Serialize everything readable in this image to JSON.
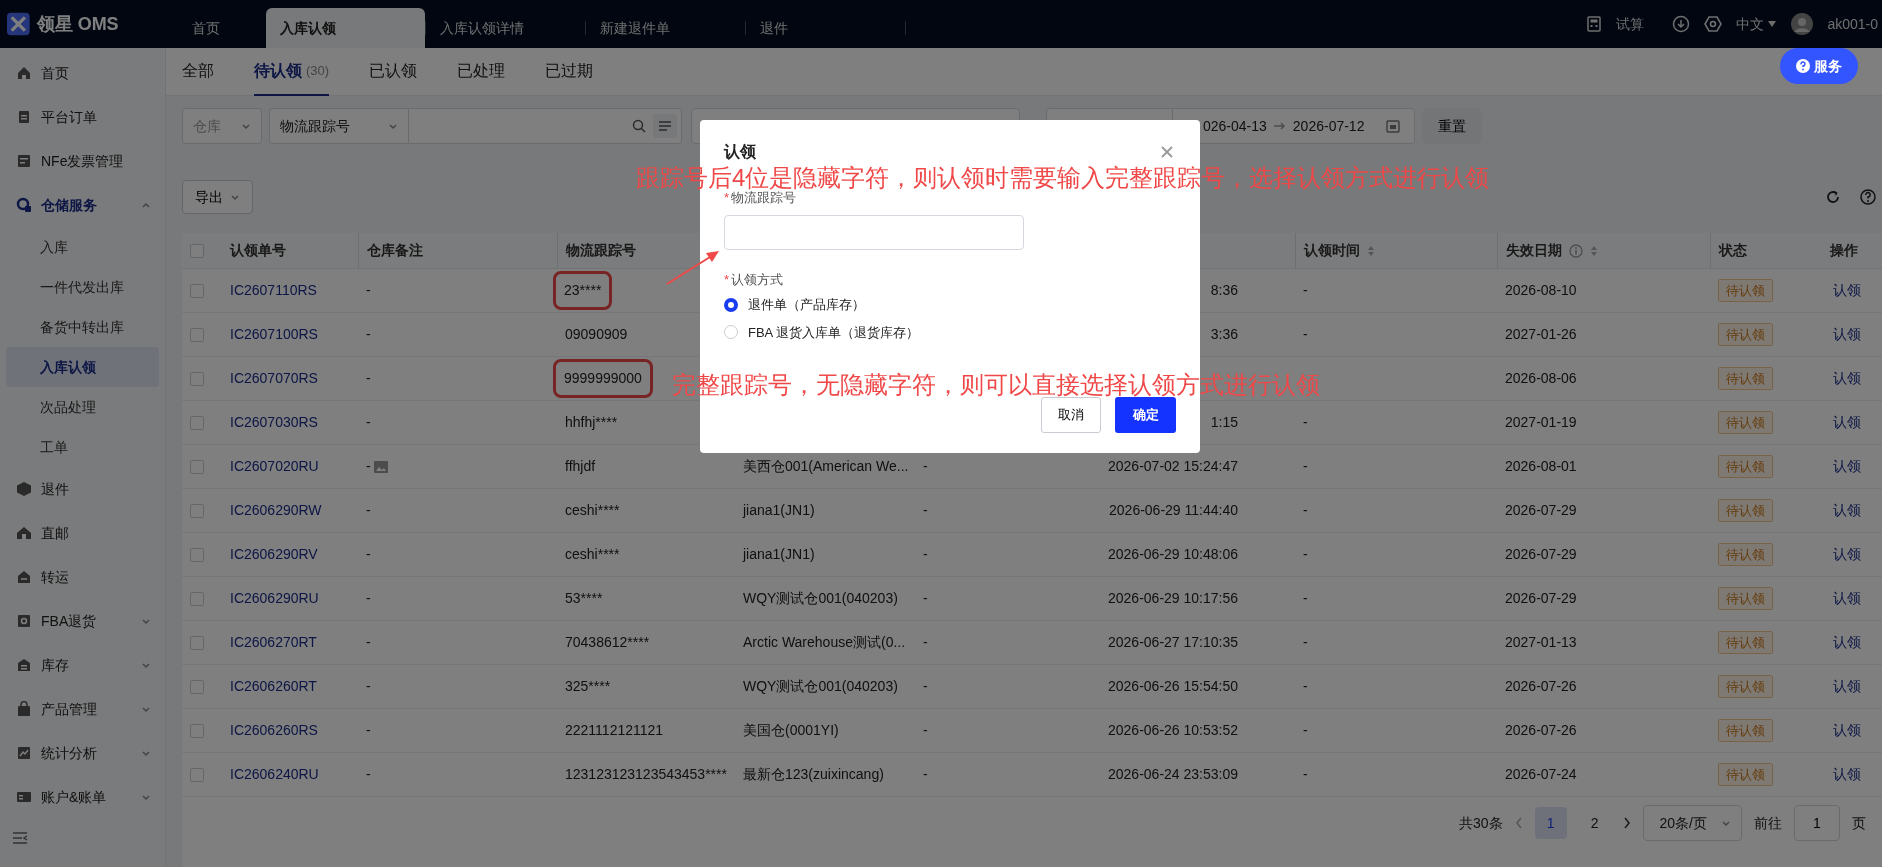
{
  "app": {
    "name": "领星 OMS"
  },
  "top_tabs": [
    {
      "label": "首页",
      "selected": false
    },
    {
      "label": "入库认领",
      "selected": true
    },
    {
      "label": "入库认领详情",
      "selected": false
    },
    {
      "label": "新建退件单",
      "selected": false
    },
    {
      "label": "退件",
      "selected": false
    }
  ],
  "top_right": {
    "calc": "试算",
    "language": "中文",
    "user": "ak001-0"
  },
  "service_button": "服务",
  "sidebar": {
    "items": [
      {
        "label": "首页"
      },
      {
        "label": "平台订单"
      },
      {
        "label": "NFe发票管理"
      },
      {
        "label": "仓储服务",
        "expanded": true,
        "children": [
          {
            "label": "入库",
            "selected": false
          },
          {
            "label": "一件代发出库",
            "selected": false
          },
          {
            "label": "备货中转出库",
            "selected": false
          },
          {
            "label": "入库认领",
            "selected": true
          },
          {
            "label": "次品处理",
            "selected": false
          },
          {
            "label": "工单",
            "selected": false
          }
        ]
      },
      {
        "label": "退件"
      },
      {
        "label": "直邮"
      },
      {
        "label": "转运"
      },
      {
        "label": "FBA退货",
        "expanded": false
      },
      {
        "label": "库存",
        "expanded": false
      },
      {
        "label": "产品管理",
        "expanded": false
      },
      {
        "label": "统计分析",
        "expanded": false
      },
      {
        "label": "账户&账单",
        "expanded": false
      }
    ]
  },
  "status_tabs": [
    {
      "label": "全部",
      "selected": false
    },
    {
      "label": "待认领",
      "count": "(30)",
      "selected": true
    },
    {
      "label": "已认领",
      "selected": false
    },
    {
      "label": "已处理",
      "selected": false
    },
    {
      "label": "已过期",
      "selected": false
    }
  ],
  "filters": {
    "warehouse_placeholder": "仓库",
    "search_type": "物流跟踪号",
    "date_start": "026-04-13",
    "date_end": "2026-07-12",
    "reset": "重置"
  },
  "export_button": "导出",
  "table": {
    "all_checked": false,
    "columns": [
      {
        "label": "认领单号"
      },
      {
        "label": "仓库备注"
      },
      {
        "label": "物流跟踪号"
      },
      {
        "label": "认领时间",
        "sortable": true
      },
      {
        "label": "失效日期",
        "sortable": true,
        "info": true
      },
      {
        "label": "状态"
      },
      {
        "label": "操作"
      }
    ],
    "rows": [
      {
        "checked": false,
        "id": "IC2607110RS",
        "remark": "-",
        "tracking": "23****",
        "highlighted": true,
        "column_6": "8:36",
        "claim_time": "-",
        "expiry": "2026-08-10",
        "status": "待认领",
        "action": "认领"
      },
      {
        "checked": false,
        "id": "IC2607100RS",
        "remark": "-",
        "tracking": "09090909",
        "highlighted": false,
        "column_6": "3:36",
        "claim_time": "-",
        "expiry": "2027-01-26",
        "status": "待认领",
        "action": "认领"
      },
      {
        "checked": false,
        "id": "IC2607070RS",
        "remark": "-",
        "tracking": "9999999000",
        "highlighted": true,
        "expiry": "2026-08-06",
        "status": "待认领",
        "action": "认领"
      },
      {
        "checked": false,
        "id": "IC2607030RS",
        "remark": "-",
        "tracking": "hhfhj****",
        "highlighted": false,
        "column_6": "1:15",
        "claim_time": "-",
        "expiry": "2027-01-19",
        "status": "待认领",
        "action": "认领"
      },
      {
        "checked": false,
        "id": "IC2607020RU",
        "remark": "-",
        "remark_image": true,
        "tracking": "ffhjdf",
        "highlighted": false,
        "column_4": "美西仓001(American We...",
        "column_5": "-",
        "column_6": "2026-07-02 15:24:47",
        "claim_time": "-",
        "expiry": "2026-08-01",
        "status": "待认领",
        "action": "认领"
      },
      {
        "checked": false,
        "id": "IC2606290RW",
        "remark": "-",
        "tracking": "ceshi****",
        "highlighted": false,
        "column_4": "jiana1(JN1)",
        "column_5": "-",
        "column_6": "2026-06-29 11:44:40",
        "claim_time": "-",
        "expiry": "2026-07-29",
        "status": "待认领",
        "action": "认领"
      },
      {
        "checked": false,
        "id": "IC2606290RV",
        "remark": "-",
        "tracking": "ceshi****",
        "highlighted": false,
        "column_4": "jiana1(JN1)",
        "column_5": "-",
        "column_6": "2026-06-29 10:48:06",
        "claim_time": "-",
        "expiry": "2026-07-29",
        "status": "待认领",
        "action": "认领"
      },
      {
        "checked": false,
        "id": "IC2606290RU",
        "remark": "-",
        "tracking": "53****",
        "highlighted": false,
        "column_4": "WQY测试仓001(040203)",
        "column_5": "-",
        "column_6": "2026-06-29 10:17:56",
        "claim_time": "-",
        "expiry": "2026-07-29",
        "status": "待认领",
        "action": "认领"
      },
      {
        "checked": false,
        "id": "IC2606270RT",
        "remark": "-",
        "tracking": "70438612****",
        "highlighted": false,
        "column_4": "Arctic Warehouse测试(0...",
        "column_5": "-",
        "column_6": "2026-06-27 17:10:35",
        "claim_time": "-",
        "expiry": "2027-01-13",
        "status": "待认领",
        "action": "认领"
      },
      {
        "checked": false,
        "id": "IC2606260RT",
        "remark": "-",
        "tracking": "325****",
        "highlighted": false,
        "column_4": "WQY测试仓001(040203)",
        "column_5": "-",
        "column_6": "2026-06-26 15:54:50",
        "claim_time": "-",
        "expiry": "2026-07-26",
        "status": "待认领",
        "action": "认领"
      },
      {
        "checked": false,
        "id": "IC2606260RS",
        "remark": "-",
        "tracking": "2221112121121",
        "highlighted": false,
        "column_4": "美国仓(0001YI)",
        "column_5": "-",
        "column_6": "2026-06-26 10:53:52",
        "claim_time": "-",
        "expiry": "2026-07-26",
        "status": "待认领",
        "action": "认领"
      },
      {
        "checked": false,
        "id": "IC2606240RU",
        "remark": "-",
        "tracking": "123123123123543453****",
        "highlighted": false,
        "column_4": "最新仓123(zuixincang)",
        "column_5": "-",
        "column_6": "2026-06-24 23:53:09",
        "claim_time": "-",
        "expiry": "2026-07-24",
        "status": "待认领",
        "action": "认领"
      }
    ]
  },
  "pagination": {
    "total": "共30条",
    "pages": [
      {
        "label": "1",
        "selected": true
      },
      {
        "label": "2",
        "selected": false
      }
    ],
    "page_size": "20条/页",
    "goto_label": "前往",
    "goto_value": "1",
    "goto_unit": "页"
  },
  "dialog": {
    "title": "认领",
    "tracking_label": "物流跟踪号",
    "tracking_required": "*",
    "method_label": "认领方式",
    "method_required": "*",
    "options": [
      {
        "label": "退件单（产品库存）",
        "selected": true
      },
      {
        "label": "FBA 退货入库单（退货库存）",
        "selected": false
      }
    ],
    "cancel": "取消",
    "confirm": "确定"
  },
  "annotations": [
    {
      "text": "跟踪号后4位是隐藏字符，则认领时需要输入完整跟踪号，选择认领方式进行认领",
      "arrow": true
    },
    {
      "text": "完整跟踪号，无隐藏字符，则可以直接选择认领方式进行认领"
    }
  ]
}
